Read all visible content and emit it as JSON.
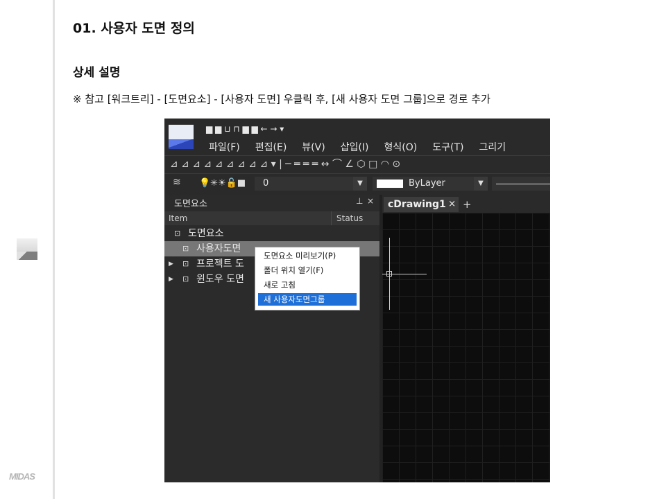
{
  "doc": {
    "title": "01. 사용자 도면 정의",
    "subtitle": "상세 설명",
    "note": "※ 참고 [워크트리] - [도면요소] - [사용자 도면] 우클릭 후, [새 사용자 도면 그룹]으로 경로 추가",
    "brand": "MIDAS"
  },
  "app": {
    "quick_access": "▆ ▆ ⊔ ⊓ ▆ ▆ ← → ▾",
    "menu": [
      "파일(F)",
      "편집(E)",
      "뷰(V)",
      "삽입(I)",
      "형식(O)",
      "도구(T)",
      "그리기"
    ],
    "toolbar_glyphs": "⊿ ⊿ ⊿ ⊿ ⊿ ⊿ ⊿ ⊿ ⊿ ▾ | ─ ═ ═ ═ ↔ ⌒ ∠ ⬡ □ ◠ ⊙",
    "layer_icons": "💡✳☀🔓■",
    "layer_value": "0",
    "color_value": "ByLayer",
    "panel": {
      "title": "도면요소",
      "pin": "⊥",
      "close": "×",
      "col_item": "Item",
      "col_status": "Status",
      "rows": [
        {
          "label": "도면요소",
          "icon": "⊡",
          "expand": ""
        },
        {
          "label": "사용자도면",
          "icon": "⊡",
          "expand": ""
        },
        {
          "label": "프로젝트 도",
          "icon": "⊡",
          "expand": "▶"
        },
        {
          "label": "윈도우 도면",
          "icon": "⊡",
          "expand": "▶"
        }
      ]
    },
    "context_menu": [
      "도면요소 미리보기(P)",
      "폴더 위치 열기(F)",
      "새로 고침",
      "새 사용자도면그룹"
    ],
    "doc_tab": "cDrawing1",
    "tab_close": "×",
    "tab_add": "+"
  }
}
